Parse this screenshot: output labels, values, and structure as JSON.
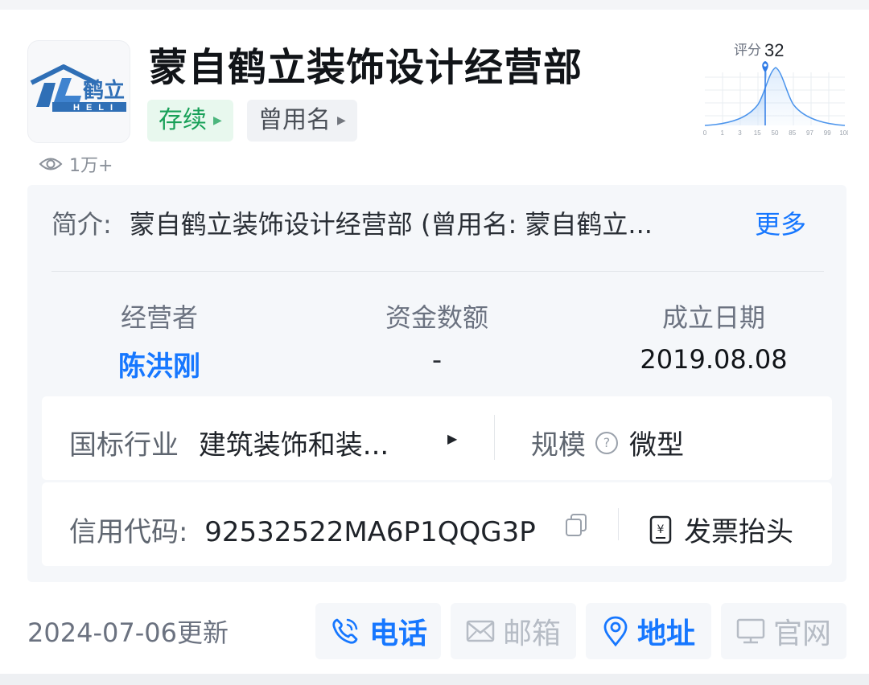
{
  "company": {
    "name": "蒙自鹤立装饰设计经营部",
    "status_tag": "存续",
    "former_name_tag": "曾用名",
    "views": "1万+",
    "logo": {
      "brand_cn": "鹤立",
      "brand_en": "HELI"
    }
  },
  "score": {
    "label": "评分",
    "value": "32",
    "axis_ticks": [
      "0",
      "1",
      "3",
      "15",
      "50",
      "85",
      "97",
      "99",
      "100"
    ]
  },
  "intro": {
    "label": "简介:",
    "text": "蒙自鹤立装饰设计经营部 (曾用名: 蒙自鹤立...",
    "more": "更多"
  },
  "stats": {
    "operator_label": "经营者",
    "operator_value": "陈洪刚",
    "capital_label": "资金数额",
    "capital_value": "-",
    "founded_label": "成立日期",
    "founded_value": "2019.08.08"
  },
  "industry": {
    "label": "国标行业",
    "value": "建筑装饰和装..."
  },
  "scale": {
    "label": "规模",
    "value": "微型"
  },
  "credit": {
    "label": "信用代码:",
    "value": "92532522MA6P1QQG3P"
  },
  "invoice": {
    "label": "发票抬头"
  },
  "footer": {
    "updated": "2024-07-06更新",
    "actions": [
      {
        "label": "电话",
        "icon": "phone-icon",
        "enabled": true
      },
      {
        "label": "邮箱",
        "icon": "mail-icon",
        "enabled": false
      },
      {
        "label": "地址",
        "icon": "location-pin-icon",
        "enabled": true
      },
      {
        "label": "官网",
        "icon": "monitor-icon",
        "enabled": false
      }
    ]
  },
  "colors": {
    "accent": "#1677ff",
    "status_green": "#18a058",
    "muted": "#b6bcc5"
  }
}
